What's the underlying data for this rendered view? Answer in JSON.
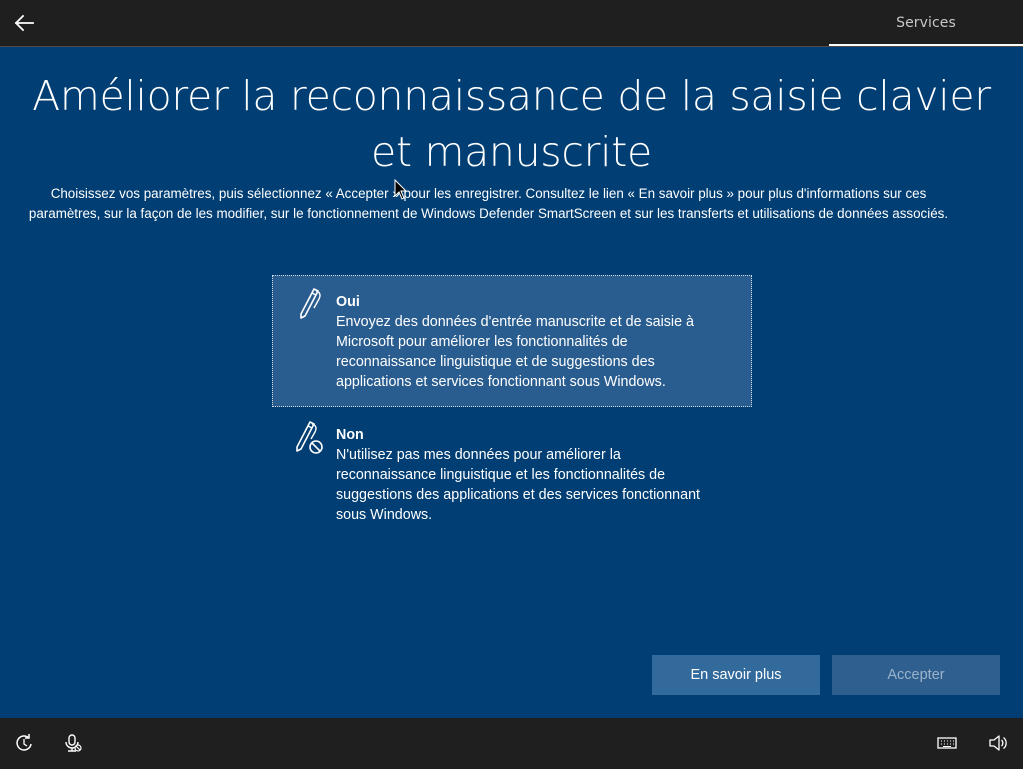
{
  "topbar": {
    "back_icon": "arrow-left-icon",
    "section_label": "Services"
  },
  "main": {
    "title": "Améliorer la reconnaissance de la saisie clavier et manuscrite",
    "subtitle": "Choisissez vos paramètres, puis sélectionnez « Accepter » pour les enregistrer. Consultez le lien « En savoir plus » pour plus d'informations sur ces paramètres, sur la façon de les modifier, sur le fonctionnement de Windows Defender SmartScreen et sur les transferts et utilisations de données associés."
  },
  "options": [
    {
      "icon": "pen-icon",
      "title": "Oui",
      "description": "Envoyez des données d'entrée manuscrite et de saisie à Microsoft pour améliorer les fonctionnalités de reconnaissance linguistique et de suggestions des applications et services fonctionnant sous Windows.",
      "selected": true
    },
    {
      "icon": "pen-blocked-icon",
      "title": "Non",
      "description": "N'utilisez pas mes données pour améliorer la reconnaissance linguistique et les fonctionnalités de suggestions des applications et des services fonctionnant sous Windows.",
      "selected": false
    }
  ],
  "buttons": {
    "learn_more": "En savoir plus",
    "accept": "Accepter",
    "accept_enabled": false
  },
  "bottombar": {
    "left_icons": [
      "ease-of-access-icon",
      "microphone-icon"
    ],
    "right_icons": [
      "keyboard-icon",
      "volume-icon"
    ]
  },
  "colors": {
    "background": "#003e73",
    "bar": "#1f1f1f",
    "selected_option": "#2a5d8f",
    "button": "#336a9c"
  }
}
